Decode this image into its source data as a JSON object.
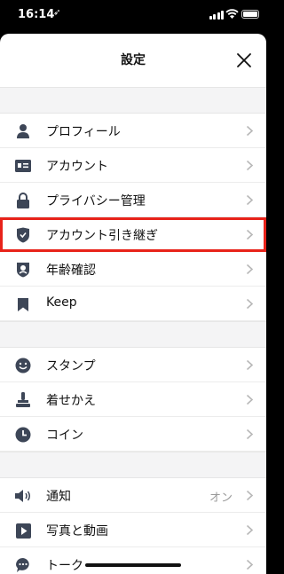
{
  "status": {
    "time": "16:14",
    "location_glyph": "➶"
  },
  "header": {
    "title": "設定"
  },
  "sections": [
    {
      "items": [
        {
          "label": "プロフィール",
          "icon": "person-icon"
        },
        {
          "label": "アカウント",
          "icon": "id-card-icon"
        },
        {
          "label": "プライバシー管理",
          "icon": "lock-icon"
        },
        {
          "label": "アカウント引き継ぎ",
          "icon": "shield-icon",
          "highlighted": true
        },
        {
          "label": "年齢確認",
          "icon": "age-badge-icon"
        },
        {
          "label": "Keep",
          "icon": "bookmark-icon"
        }
      ]
    },
    {
      "items": [
        {
          "label": "スタンプ",
          "icon": "smiley-icon"
        },
        {
          "label": "着せかえ",
          "icon": "brush-icon"
        },
        {
          "label": "コイン",
          "icon": "clock-coin-icon"
        }
      ]
    },
    {
      "items": [
        {
          "label": "通知",
          "icon": "speaker-icon",
          "value": "オン"
        },
        {
          "label": "写真と動画",
          "icon": "play-icon"
        },
        {
          "label": "トーク",
          "icon": "chat-bubble-icon"
        }
      ]
    }
  ],
  "colors": {
    "highlight": "#e8231a",
    "icon": "#3d4657"
  }
}
